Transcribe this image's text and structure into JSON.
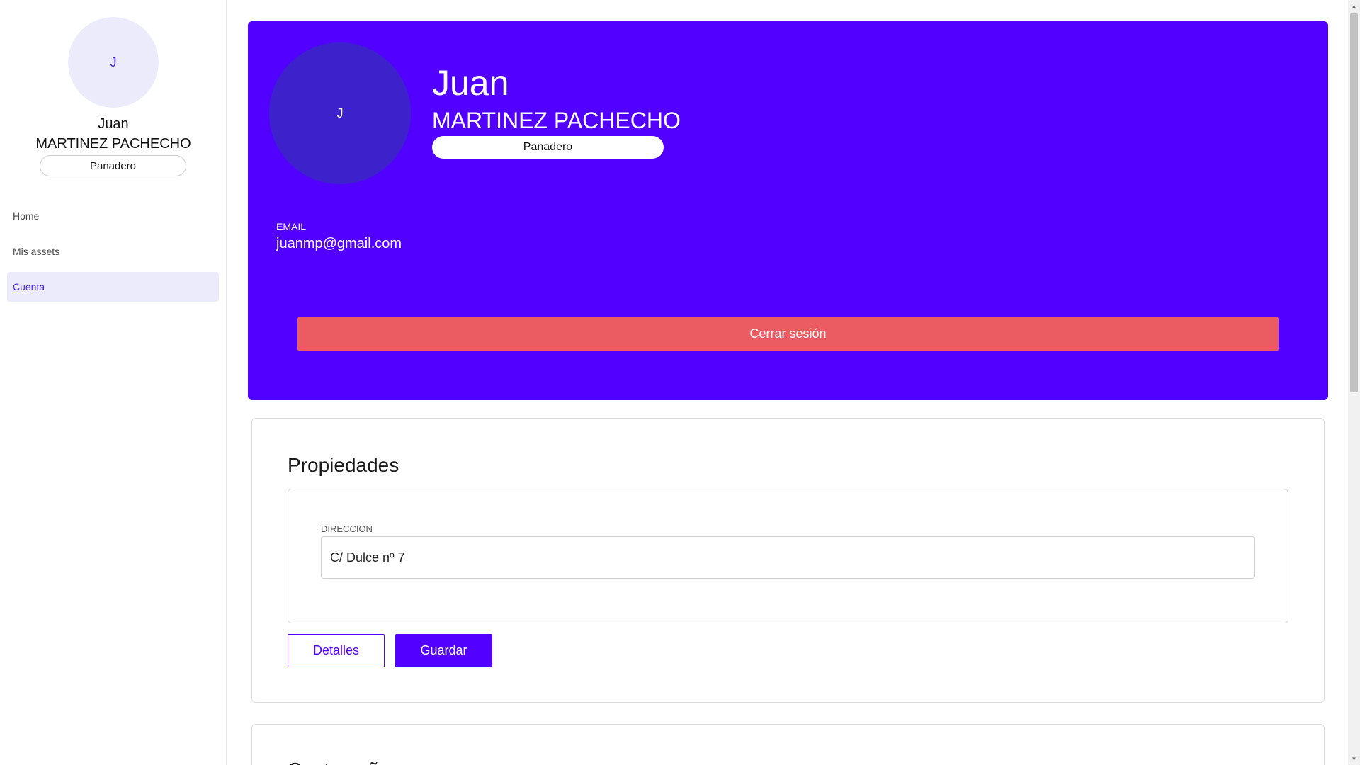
{
  "sidebar": {
    "avatar_initial": "J",
    "first_name": "Juan",
    "last_name": "MARTINEZ PACHECHO",
    "role": "Panadero",
    "nav": [
      {
        "label": "Home",
        "active": false
      },
      {
        "label": "Mis assets",
        "active": false
      },
      {
        "label": "Cuenta",
        "active": true
      }
    ]
  },
  "profile": {
    "avatar_initial": "J",
    "first_name": "Juan",
    "last_name": "MARTINEZ PACHECHO",
    "role": "Panadero",
    "email_label": "EMAIL",
    "email": "juanmp@gmail.com",
    "logout_label": "Cerrar sesión"
  },
  "properties": {
    "title": "Propiedades",
    "address_label": "DIRECCION",
    "address_value": "C/ Dulce nº 7",
    "details_label": "Detalles",
    "save_label": "Guardar"
  },
  "next_card": {
    "title": "Contraseña"
  },
  "colors": {
    "primary": "#5200ff",
    "danger": "#eb5c62",
    "avatar_light": "#ecebfc",
    "avatar_dark": "#3d22cc"
  }
}
